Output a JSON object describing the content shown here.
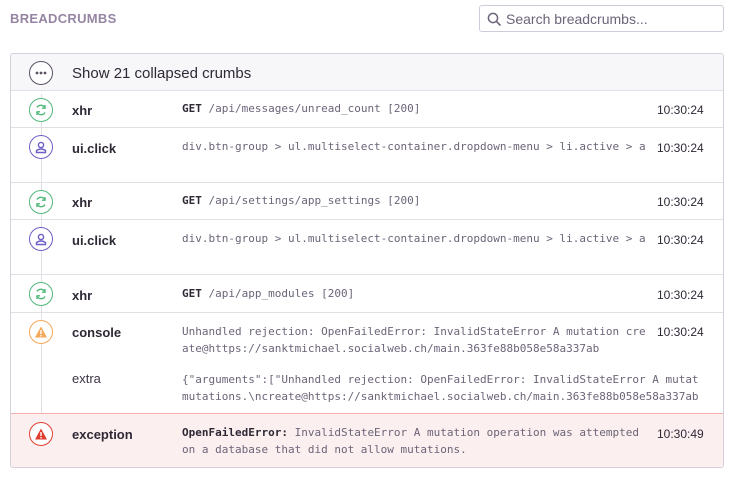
{
  "header": {
    "title": "BREADCRUMBS",
    "search_placeholder": "Search breadcrumbs..."
  },
  "collapsed": {
    "label": "Show 21 collapsed crumbs",
    "icon": "ellipsis-icon"
  },
  "crumbs": [
    {
      "category": "xhr",
      "icon": "refresh-icon",
      "method": "GET",
      "path": "/api/messages/unread_count [200]",
      "time": "10:30:24"
    },
    {
      "category": "ui.click",
      "icon": "user-icon",
      "message": "div.btn-group > ul.multiselect-container.dropdown-menu > li.active > a",
      "time": "10:30:24"
    },
    {
      "category": "xhr",
      "icon": "refresh-icon",
      "method": "GET",
      "path": "/api/settings/app_settings [200]",
      "time": "10:30:24"
    },
    {
      "category": "ui.click",
      "icon": "user-icon",
      "message": "div.btn-group > ul.multiselect-container.dropdown-menu > li.active > a",
      "time": "10:30:24"
    },
    {
      "category": "xhr",
      "icon": "refresh-icon",
      "method": "GET",
      "path": "/api/app_modules [200]",
      "time": "10:30:24"
    },
    {
      "category": "console",
      "icon": "warning-icon",
      "message": "Unhandled rejection: OpenFailedError: InvalidStateError A mutation create@https://sanktmichael.socialweb.ch/main.363fe88b058e58a337ab",
      "time": "10:30:24",
      "extra_label": "extra",
      "extra_line1": "{\"arguments\":[\"Unhandled rejection: OpenFailedError: InvalidStateError A mutat",
      "extra_line2": "mutations.\\ncreate@https://sanktmichael.socialweb.ch/main.363fe88b058e58a337ab"
    },
    {
      "category": "exception",
      "icon": "error-icon",
      "error_type": "OpenFailedError:",
      "message": " InvalidStateError A mutation operation was attempted on a database that did not allow mutations.",
      "time": "10:30:49"
    }
  ],
  "colors": {
    "xhr": "#4fb87a",
    "ui_click": "#6c5fc7",
    "console": "#f5a85a",
    "exception": "#e03e2f"
  }
}
